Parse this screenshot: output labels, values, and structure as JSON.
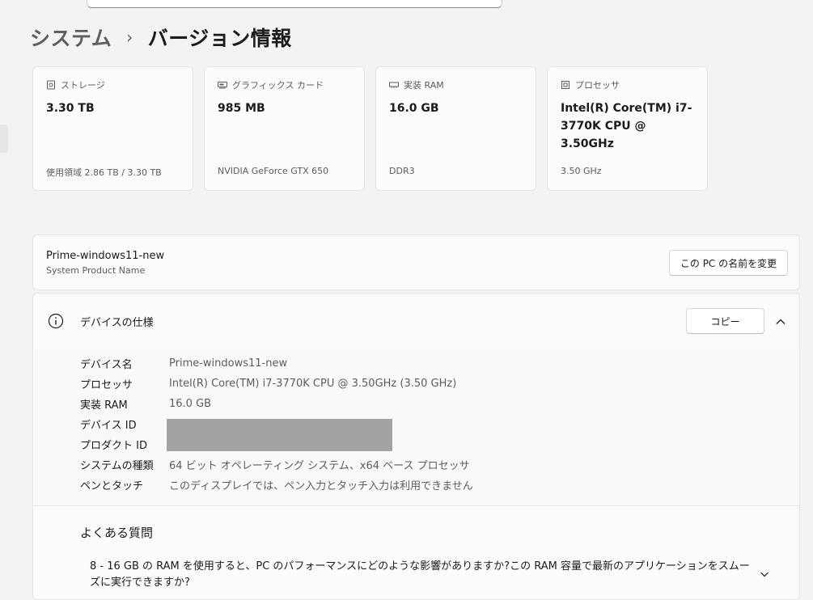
{
  "breadcrumb": {
    "parent": "システム",
    "separator": "›",
    "current": "バージョン情報"
  },
  "cards": [
    {
      "icon": "storage-icon",
      "label": "ストレージ",
      "value": "3.30 TB",
      "sub": "使用領域 2.86 TB / 3.30 TB"
    },
    {
      "icon": "graphics-card-icon",
      "label": "グラフィックス カード",
      "value": "985 MB",
      "sub": "NVIDIA GeForce GTX 650"
    },
    {
      "icon": "ram-icon",
      "label": "実装 RAM",
      "value": "16.0 GB",
      "sub": "DDR3"
    },
    {
      "icon": "processor-icon",
      "label": "プロセッサ",
      "value": "Intel(R) Core(TM) i7-3770K CPU @ 3.50GHz",
      "sub": "3.50 GHz"
    }
  ],
  "device": {
    "name": "Prime-windows11-new",
    "sub": "System Product Name",
    "rename_label": "この PC の名前を変更"
  },
  "specs": {
    "title": "デバイスの仕様",
    "copy_label": "コピー",
    "rows": [
      {
        "key": "デバイス名",
        "value": "Prime-windows11-new"
      },
      {
        "key": "プロセッサ",
        "value": "Intel(R) Core(TM) i7-3770K CPU @ 3.50GHz (3.50 GHz)"
      },
      {
        "key": "実装 RAM",
        "value": "16.0 GB"
      },
      {
        "key": "デバイス ID",
        "value": ""
      },
      {
        "key": "プロダクト ID",
        "value": ""
      },
      {
        "key": "システムの種類",
        "value": "64 ビット オペレーティング システム、x64 ベース プロセッサ"
      },
      {
        "key": "ペンとタッチ",
        "value": "このディスプレイでは、ペン入力とタッチ入力は利用できません"
      }
    ]
  },
  "faq": {
    "title": "よくある質問",
    "question": "8 - 16 GB の RAM を使用すると、PC のパフォーマンスにどのような影響がありますか?この RAM 容量で最新のアプリケーションをスムーズに実行できますか?"
  },
  "colors": {
    "background": "#f3f3f3",
    "card": "#fbfbfb",
    "border": "#e5e5e5",
    "redaction": "#a3a3a3"
  }
}
